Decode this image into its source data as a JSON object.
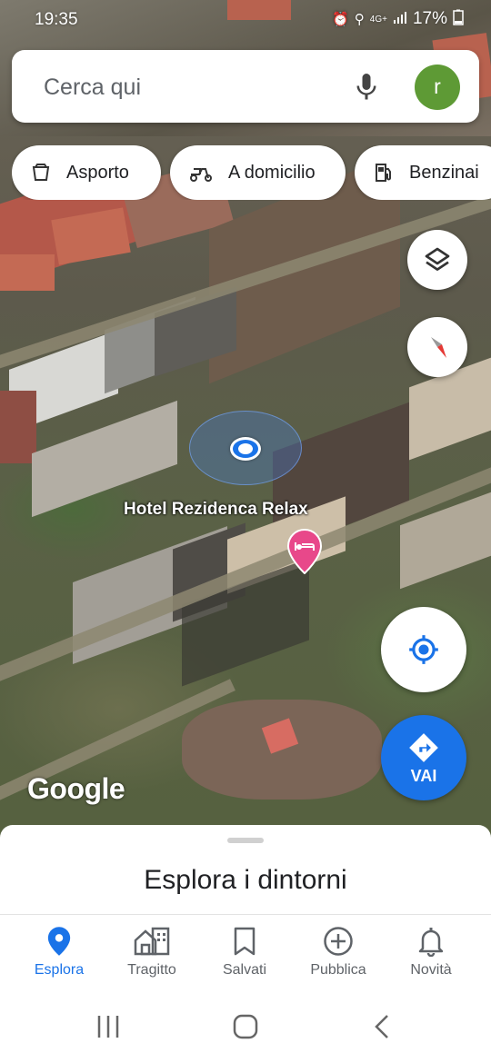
{
  "status_bar": {
    "time": "19:35",
    "battery": "17%",
    "network": "4G+"
  },
  "search": {
    "placeholder": "Cerca qui",
    "avatar_letter": "r",
    "avatar_color": "#5e9a35"
  },
  "chips": [
    {
      "label": "Asporto",
      "icon": "takeout-bag-icon"
    },
    {
      "label": "A domicilio",
      "icon": "delivery-scooter-icon"
    },
    {
      "label": "Benzinai",
      "icon": "gas-station-icon"
    }
  ],
  "map": {
    "place_label": "Hotel Rezidenca Relax",
    "place_pin_color": "#e8488a",
    "attribution": "Google"
  },
  "directions_button": {
    "label": "VAI"
  },
  "bottom_sheet": {
    "title": "Esplora i dintorni"
  },
  "bottom_nav": {
    "items": [
      {
        "label": "Esplora",
        "icon": "pin-icon",
        "active": true
      },
      {
        "label": "Tragitto",
        "icon": "commute-icon",
        "active": false
      },
      {
        "label": "Salvati",
        "icon": "bookmark-icon",
        "active": false
      },
      {
        "label": "Pubblica",
        "icon": "add-circle-icon",
        "active": false
      },
      {
        "label": "Novità",
        "icon": "bell-icon",
        "active": false
      }
    ]
  },
  "colors": {
    "accent": "#1a73e8",
    "inactive_text": "#5f6368"
  }
}
